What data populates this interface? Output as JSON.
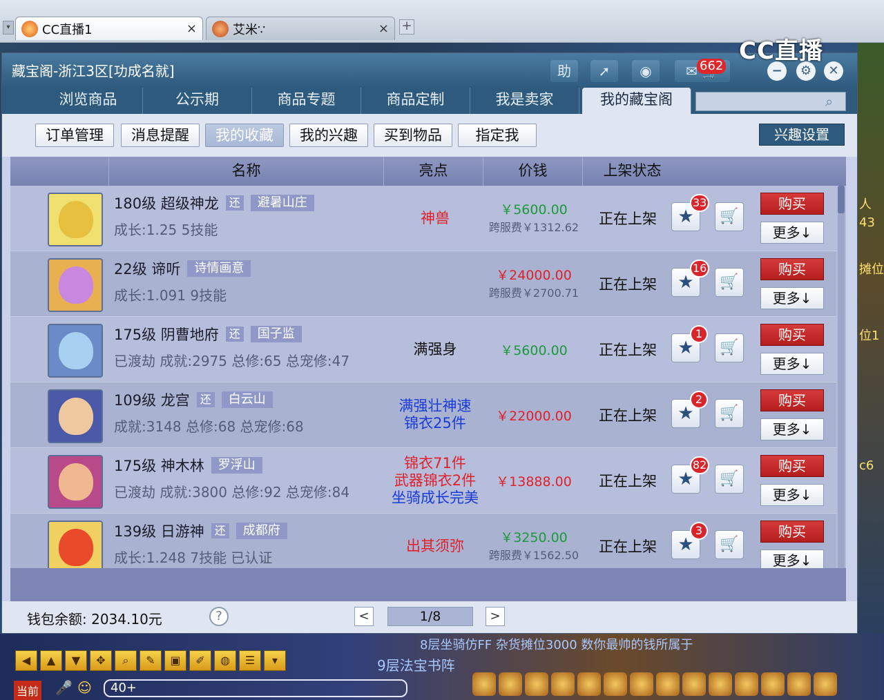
{
  "browser": {
    "tabs": [
      {
        "label": "CC直播1",
        "active": true
      },
      {
        "label": "艾米∵",
        "active": false
      }
    ],
    "new_tab": "+",
    "close": "×"
  },
  "brand": {
    "logo_text": "CC直播"
  },
  "window": {
    "title": "藏宝阁-浙江3区[功成名就]",
    "toolbar": {
      "help": "助",
      "message_count": "662"
    },
    "nav_tabs": [
      "浏览商品",
      "公示期",
      "商品专题",
      "商品定制",
      "我是卖家",
      "我的藏宝阁"
    ],
    "active_nav": 5,
    "sub_tabs": [
      "订单管理",
      "消息提醒",
      "我的收藏",
      "我的兴趣",
      "买到物品",
      "指定我"
    ],
    "active_sub": 2,
    "interest_settings": "兴趣设置",
    "table": {
      "headers": [
        "名称",
        "亮点",
        "价钱",
        "上架状态"
      ],
      "rows": [
        {
          "level_name": "180级 超级神龙",
          "huan": "还",
          "server": "避暑山庄",
          "detail": "成长:1.25 5技能",
          "highlight": [
            "神兽"
          ],
          "hl_color": "#e0202a",
          "price": "￥5600.00",
          "price_color": "#1a9a3a",
          "fee": "跨服费￥1312.62",
          "status": "正在上架",
          "fav_count": "33",
          "avatar_color": "#e8c040",
          "bg": "#f0e070"
        },
        {
          "level_name": "22级 谛听",
          "huan": "",
          "server": "诗情画意",
          "detail": "成长:1.091 9技能",
          "highlight": [],
          "hl_color": "#e0202a",
          "price": "￥24000.00",
          "price_color": "#e0202a",
          "fee": "跨服费￥2700.71",
          "status": "正在上架",
          "fav_count": "16",
          "avatar_color": "#c888e0",
          "bg": "#e8b050"
        },
        {
          "level_name": "175级 阴曹地府",
          "huan": "还",
          "server": "国子监",
          "detail": "已渡劫 成就:2975 总修:65 总宠修:47",
          "highlight": [
            "满强身"
          ],
          "hl_color": "#111111",
          "price": "￥5600.00",
          "price_color": "#1a9a3a",
          "fee": "",
          "status": "正在上架",
          "fav_count": "1",
          "avatar_color": "#a8d0f0",
          "bg": "#6a8ac8"
        },
        {
          "level_name": "109级 龙宫",
          "huan": "还",
          "server": "白云山",
          "detail": "成就:3148 总修:68 总宠修:68",
          "highlight": [
            "满强壮神速",
            "锦衣25件"
          ],
          "hl_color": "#1a3ad8",
          "price": "￥22000.00",
          "price_color": "#e0202a",
          "fee": "",
          "status": "正在上架",
          "fav_count": "2",
          "avatar_color": "#f0c8a0",
          "bg": "#4a5aa8"
        },
        {
          "level_name": "175级 神木林",
          "huan": "",
          "server": "罗浮山",
          "detail": "已渡劫 成就:3800 总修:92 总宠修:84",
          "highlight": [
            "锦衣71件",
            "武器锦衣2件",
            "坐骑成长完美"
          ],
          "hl_colors": [
            "#e0202a",
            "#e0202a",
            "#1a3ad8"
          ],
          "price": "￥13888.00",
          "price_color": "#e0202a",
          "fee": "",
          "status": "正在上架",
          "fav_count": "82",
          "avatar_color": "#f0b890",
          "bg": "#b84a8a"
        },
        {
          "level_name": "139级 日游神",
          "huan": "还",
          "server": "成都府",
          "detail": "成长:1.248 7技能 已认证",
          "highlight": [
            "出其须弥"
          ],
          "hl_color": "#e0202a",
          "price": "￥3250.00",
          "price_color": "#1a9a3a",
          "fee": "跨服费￥1562.50",
          "status": "正在上架",
          "fav_count": "3",
          "avatar_color": "#e84a2a",
          "bg": "#f0d060"
        }
      ],
      "buy_label": "购买",
      "more_label": "更多↓"
    },
    "footer": {
      "wallet": "钱包余额: 2034.10元",
      "help": "?",
      "prev": "<",
      "page": "1/8",
      "next": ">"
    }
  },
  "hud": {
    "channel": "当前",
    "chat_text": "40+",
    "ticker": "8层坐骑仿FF  杂货摊位3000  数你最帅的钱所属于",
    "ticker2": "9层法宝书阵"
  },
  "side_labels": [
    "人",
    "43",
    "摊位",
    "位1",
    "c6"
  ]
}
